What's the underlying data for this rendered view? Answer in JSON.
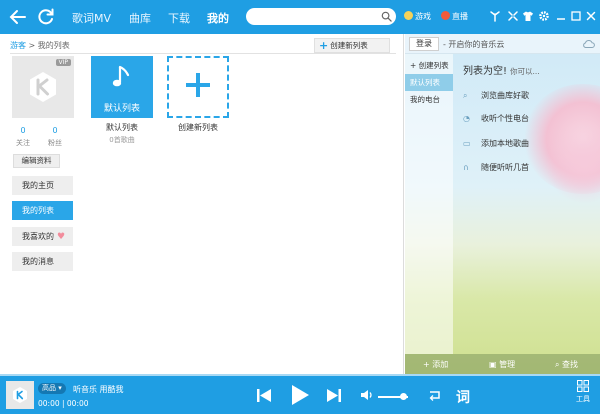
{
  "header": {
    "tabs": [
      {
        "label": "歌词MV"
      },
      {
        "label": "曲库"
      },
      {
        "label": "下载"
      },
      {
        "label": "我的"
      }
    ],
    "search": {
      "value": "",
      "placeholder": ""
    },
    "links": [
      {
        "label": "游戏"
      },
      {
        "label": "直播"
      }
    ]
  },
  "left": {
    "breadcrumb": {
      "guest": "游客",
      "separator": " > ",
      "current": "我的列表"
    },
    "create_button": "创建新列表",
    "vip_badge": "VIP",
    "stats": [
      {
        "value": "0",
        "label": "关注"
      },
      {
        "value": "0",
        "label": "粉丝"
      }
    ],
    "edit_button": "编辑资料",
    "menu": [
      {
        "label": "我的主页"
      },
      {
        "label": "我的列表"
      },
      {
        "label": "我喜欢的"
      },
      {
        "label": "我的消息"
      }
    ],
    "playlists": [
      {
        "cover_label": "默认列表",
        "name": "默认列表",
        "sub": "0首歌曲"
      },
      {
        "name": "创建新列表"
      }
    ]
  },
  "right": {
    "login_button": "登录",
    "slogan": "- 开启你的音乐云",
    "tabs": [
      {
        "label": "+ 创建列表"
      },
      {
        "label": "默认列表"
      },
      {
        "label": "我的电台"
      }
    ],
    "empty_title": "列表为空!",
    "empty_question": "你可以...",
    "suggestions": [
      {
        "label": "浏览曲库好歌"
      },
      {
        "label": "收听个性电台"
      },
      {
        "label": "添加本地歌曲"
      },
      {
        "label": "随便听听几首"
      }
    ],
    "footer": [
      {
        "label": "添加"
      },
      {
        "label": "管理"
      },
      {
        "label": "查找"
      }
    ]
  },
  "player": {
    "quality": "高品 ▾",
    "track": "听音乐 用酷我",
    "time": "00:00 | 00:00",
    "lyrics_label": "词",
    "tools_label": "工具",
    "volume": 0.85
  },
  "colors": {
    "brand": "#1f9ee3",
    "active_menu": "#2aa6e8",
    "heart": "#f28c9c"
  }
}
